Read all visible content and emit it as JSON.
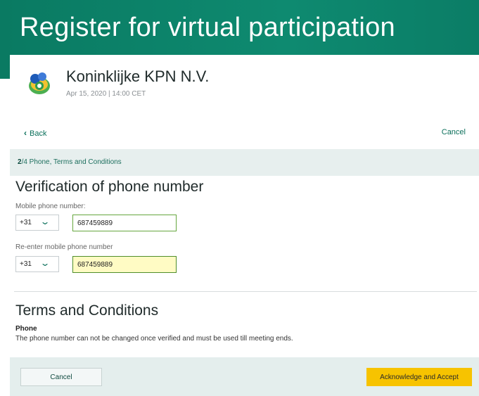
{
  "banner": {
    "title": "Register for virtual participation"
  },
  "company": {
    "name": "Koninklijke KPN N.V.",
    "meeting_date": "Apr 15, 2020 | 14:00 CET"
  },
  "nav": {
    "back_label": "Back",
    "cancel_label": "Cancel"
  },
  "step": {
    "current": "2",
    "total_suffix": "/4 Phone, Terms and Conditions"
  },
  "verification": {
    "title": "Verification of phone number",
    "mobile_label": "Mobile phone number:",
    "mobile_country_code": "+31",
    "mobile_value": "687459889",
    "reenter_label": "Re-enter mobile phone number",
    "reenter_country_code": "+31",
    "reenter_value": "687459889"
  },
  "terms": {
    "title": "Terms and Conditions",
    "phone_heading": "Phone",
    "phone_text": "The phone number can not be changed once verified and must be used till meeting ends."
  },
  "footer": {
    "cancel_label": "Cancel",
    "accept_label": "Acknowledge and Accept"
  },
  "colors": {
    "brand_green": "#0a7a62",
    "accept_yellow": "#f7c300",
    "input_focus": "#fffbc4"
  }
}
